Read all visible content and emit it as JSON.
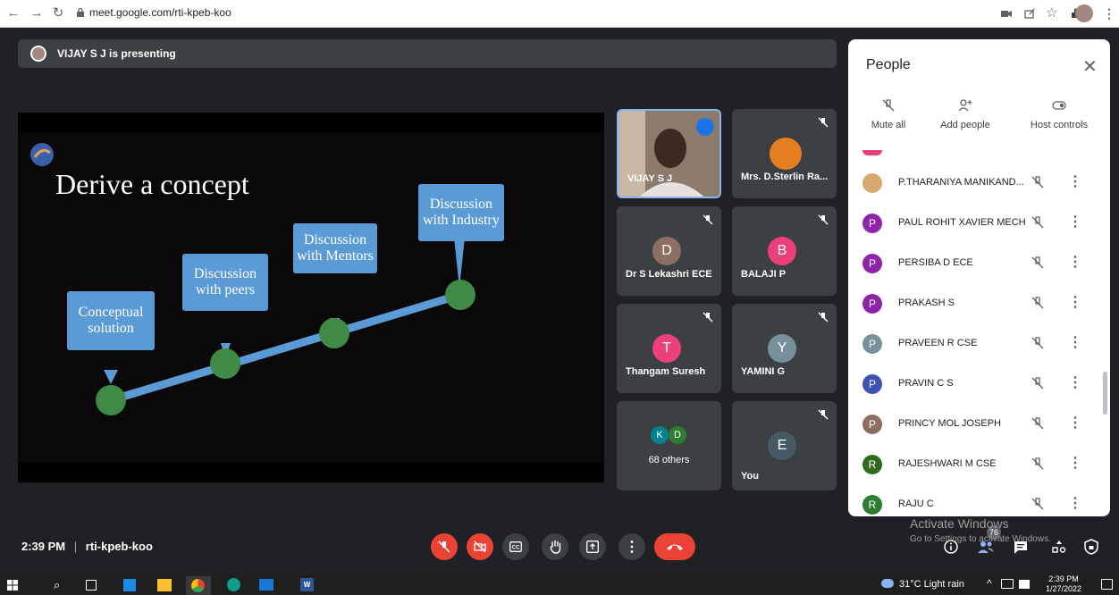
{
  "browser": {
    "url": "meet.google.com/rti-kpeb-koo"
  },
  "presenting": {
    "text": "VIJAY S J is presenting"
  },
  "slide": {
    "title": "Derive a concept",
    "callouts": [
      "Conceptual solution",
      "Discussion with peers",
      "Discussion with Mentors",
      "Discussion with Industry"
    ]
  },
  "tiles": [
    {
      "name": "VIJAY S J",
      "type": "video"
    },
    {
      "name": "Mrs. D.Sterlin Ra...",
      "type": "photo"
    },
    {
      "name": "Dr S Lekashri ECE",
      "initial": "D",
      "color": "#8d6e63"
    },
    {
      "name": "BALAJI P",
      "initial": "B",
      "color": "#ec407a"
    },
    {
      "name": "Thangam Suresh",
      "initial": "T",
      "color": "#ec407a"
    },
    {
      "name": "YAMINI G",
      "initial": "Y",
      "color": "#78909c"
    },
    {
      "name": "68 others",
      "initials": [
        "K",
        "D"
      ]
    },
    {
      "name": "You",
      "initial": "E",
      "color": "#455a64"
    }
  ],
  "people": {
    "title": "People",
    "actions": [
      "Mute all",
      "Add people",
      "Host controls"
    ],
    "list": [
      {
        "name": "P.THARANIYA MANIKAND...",
        "initial": "",
        "color": "#d7a86e"
      },
      {
        "name": "PAUL ROHIT XAVIER MECH",
        "initial": "P",
        "color": "#8e24aa"
      },
      {
        "name": "PERSIBA D ECE",
        "initial": "P",
        "color": "#8e24aa"
      },
      {
        "name": "PRAKASH S",
        "initial": "P",
        "color": "#8e24aa"
      },
      {
        "name": "PRAVEEN R CSE",
        "initial": "P",
        "color": "#78909c"
      },
      {
        "name": "PRAVIN C S",
        "initial": "P",
        "color": "#3f51b5"
      },
      {
        "name": "PRINCY MOL JOSEPH",
        "initial": "P",
        "color": "#8d6e63"
      },
      {
        "name": "RAJESHWARI M CSE",
        "initial": "R",
        "color": "#33691e"
      },
      {
        "name": "RAJU C",
        "initial": "R",
        "color": "#2e7d32"
      }
    ]
  },
  "meeting": {
    "time": "2:39 PM",
    "code": "rti-kpeb-koo",
    "participants": "76"
  },
  "windows": {
    "watermark1": "Activate Windows",
    "watermark2": "Go to Settings to activate Windows.",
    "weather": "31°C  Light rain",
    "clock": "2:39 PM",
    "date": "1/27/2022"
  }
}
